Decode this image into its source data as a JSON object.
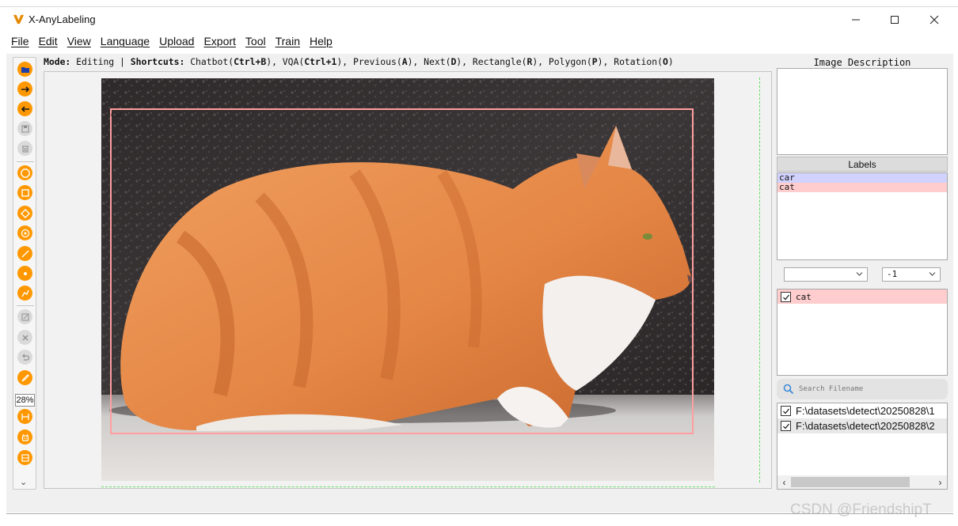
{
  "window": {
    "title": "X-AnyLabeling",
    "logo_color": "#e48a00"
  },
  "menu": [
    "File",
    "Edit",
    "View",
    "Language",
    "Upload",
    "Export",
    "Tool",
    "Train",
    "Help"
  ],
  "toolbar": {
    "zoom": "28%",
    "accent_color": "#ff9800",
    "tools": [
      {
        "icon": "open-folder-icon",
        "enabled": true
      },
      {
        "icon": "next-image-icon",
        "enabled": true
      },
      {
        "icon": "previous-image-icon",
        "enabled": true
      },
      {
        "icon": "save-icon",
        "enabled": false
      },
      {
        "icon": "delete-file-icon",
        "enabled": false
      },
      {
        "icon": "polygon-icon",
        "enabled": true
      },
      {
        "icon": "rectangle-icon",
        "enabled": true
      },
      {
        "icon": "rotation-icon",
        "enabled": true
      },
      {
        "icon": "circle-icon",
        "enabled": true
      },
      {
        "icon": "line-icon",
        "enabled": true
      },
      {
        "icon": "point-icon",
        "enabled": true
      },
      {
        "icon": "linestrip-icon",
        "enabled": true
      },
      {
        "icon": "edit-icon",
        "enabled": false
      },
      {
        "icon": "delete-shape-icon",
        "enabled": false
      },
      {
        "icon": "undo-icon",
        "enabled": false
      },
      {
        "icon": "brush-icon",
        "enabled": true
      },
      {
        "icon": "fit-width-icon",
        "enabled": true
      },
      {
        "icon": "auto-label-icon",
        "enabled": true
      },
      {
        "icon": "overview-icon",
        "enabled": true
      }
    ]
  },
  "modebar": {
    "mode_label": "Mode:",
    "mode_value": "Editing",
    "separator": "|",
    "shortcuts_label": "Shortcuts:",
    "shortcuts": [
      {
        "name": "Chatbot",
        "key": "Ctrl+B"
      },
      {
        "name": "VQA",
        "key": "Ctrl+1"
      },
      {
        "name": "Previous",
        "key": "A"
      },
      {
        "name": "Next",
        "key": "D"
      },
      {
        "name": "Rectangle",
        "key": "R"
      },
      {
        "name": "Polygon",
        "key": "P"
      },
      {
        "name": "Rotation",
        "key": "O"
      }
    ]
  },
  "canvas": {
    "shape_label": "cat",
    "shape_color": "#ff9e9e"
  },
  "panel": {
    "description_title": "Image Description",
    "labels_title": "Labels",
    "labels": [
      {
        "name": "car",
        "color": "#d2d2ff"
      },
      {
        "name": "cat",
        "color": "#ffcdcd"
      }
    ],
    "group_select": "",
    "group_id_select": "-1",
    "shapes": [
      {
        "label": "cat",
        "checked": true
      }
    ],
    "search_placeholder": "Search Filename",
    "files": [
      {
        "path": "F:\\datasets\\detect\\20250828\\1",
        "checked": true
      },
      {
        "path": "F:\\datasets\\detect\\20250828\\2",
        "checked": true
      }
    ]
  },
  "watermark": "CSDN @FriendshipT"
}
